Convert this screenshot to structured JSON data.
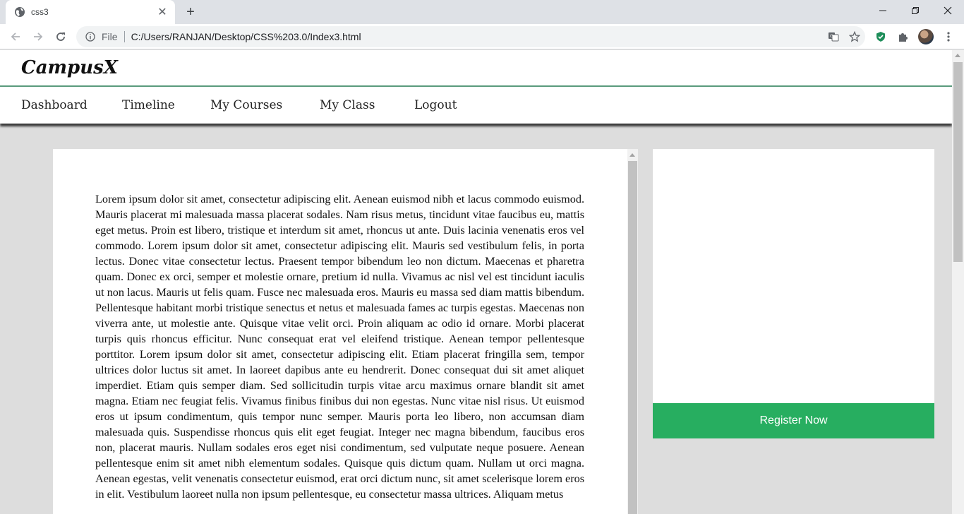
{
  "browser": {
    "tab_title": "css3",
    "url_scheme": "File",
    "url": "C:/Users/RANJAN/Desktop/CSS%203.0/Index3.html",
    "icons": [
      "globe-icon",
      "close-icon",
      "plus-icon",
      "back-icon",
      "forward-icon",
      "reload-icon",
      "info-icon",
      "translate-icon",
      "star-icon",
      "shield-icon",
      "puzzle-icon",
      "avatar",
      "kebab-menu-icon",
      "minimize-icon",
      "maximize-icon",
      "window-close-icon"
    ]
  },
  "site": {
    "brand": "CampusX",
    "nav": [
      "Dashboard",
      "Timeline",
      "My Courses",
      "My Class",
      "Logout"
    ],
    "register_label": "Register Now",
    "accent_color": "#27ae60",
    "article_text": "Lorem ipsum dolor sit amet, consectetur adipiscing elit. Aenean euismod nibh et lacus commodo euismod. Mauris placerat mi malesuada massa placerat sodales. Nam risus metus, tincidunt vitae faucibus eu, mattis eget metus. Proin est libero, tristique et interdum sit amet, rhoncus ut ante. Duis lacinia venenatis eros vel commodo. Lorem ipsum dolor sit amet, consectetur adipiscing elit. Mauris sed vestibulum felis, in porta lectus. Donec vitae consectetur lectus. Praesent tempor bibendum leo non dictum. Maecenas et pharetra quam. Donec ex orci, semper et molestie ornare, pretium id nulla. Vivamus ac nisl vel est tincidunt iaculis ut non lacus. Mauris ut felis quam. Fusce nec malesuada eros. Mauris eu massa sed diam mattis bibendum. Pellentesque habitant morbi tristique senectus et netus et malesuada fames ac turpis egestas. Maecenas non viverra ante, ut molestie ante. Quisque vitae velit orci. Proin aliquam ac odio id ornare. Morbi placerat turpis quis rhoncus efficitur. Nunc consequat erat vel eleifend tristique. Aenean tempor pellentesque porttitor. Lorem ipsum dolor sit amet, consectetur adipiscing elit. Etiam placerat fringilla sem, tempor ultrices dolor luctus sit amet. In laoreet dapibus ante eu hendrerit. Donec consequat dui sit amet aliquet imperdiet. Etiam quis semper diam. Sed sollicitudin turpis vitae arcu maximus ornare blandit sit amet magna. Etiam nec feugiat felis. Vivamus finibus finibus dui non egestas. Nunc vitae nisl risus. Ut euismod eros ut ipsum condimentum, quis tempor nunc semper. Mauris porta leo libero, non accumsan diam malesuada quis. Suspendisse rhoncus quis elit eget feugiat. Integer nec magna bibendum, faucibus eros non, placerat mauris. Nullam sodales eros eget nisi condimentum, sed vulputate neque posuere. Aenean pellentesque enim sit amet nibh elementum sodales. Quisque quis dictum quam. Nullam ut orci magna. Aenean egestas, velit venenatis consectetur euismod, erat orci dictum nunc, sit amet scelerisque lorem eros in elit. Vestibulum laoreet nulla non ipsum pellentesque, eu consectetur massa ultrices. Aliquam metus"
  }
}
